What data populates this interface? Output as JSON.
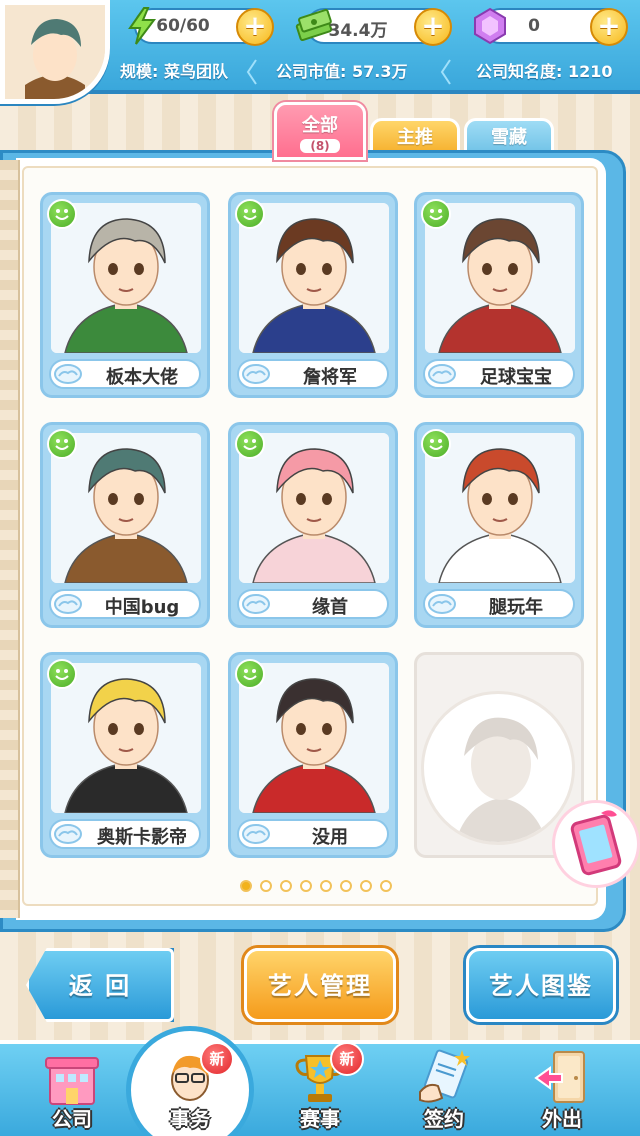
{
  "status": {
    "energy": "60/60",
    "money": "34.4万",
    "gems": "0",
    "scale": "规模: 菜鸟团队",
    "market_value": "公司市值: 57.3万",
    "fame": "公司知名度: 1210"
  },
  "tabs": [
    {
      "label": "全部",
      "count": "(8)"
    },
    {
      "label": "主推"
    },
    {
      "label": "雪藏"
    }
  ],
  "artists": [
    {
      "name": "板本大佬",
      "hair": "#b8b4a8",
      "shirt": "#3c8a3c"
    },
    {
      "name": "詹将军",
      "hair": "#6b3a22",
      "shirt": "#2b3f8c"
    },
    {
      "name": "足球宝宝",
      "hair": "#6b4632",
      "shirt": "#b4332e"
    },
    {
      "name": "中国bug",
      "hair": "#4f7a74",
      "shirt": "#8a5a2e"
    },
    {
      "name": "缘首",
      "hair": "#f59aa6",
      "shirt": "#f7d3d8"
    },
    {
      "name": "腿玩年",
      "hair": "#c94a2c",
      "shirt": "#ffffff"
    },
    {
      "name": "奥斯卡影帝",
      "hair": "#f2d24a",
      "shirt": "#2a2a2a"
    },
    {
      "name": "没用",
      "hair": "#3a3030",
      "shirt": "#c92a2a"
    }
  ],
  "page_dots": {
    "total": 8,
    "active": 0
  },
  "buttons": {
    "back": "返 回",
    "manage": "艺人管理",
    "album": "艺人图鉴"
  },
  "nav": [
    {
      "label": "公司",
      "badge": ""
    },
    {
      "label": "事务",
      "badge": "新"
    },
    {
      "label": "赛事",
      "badge": "新"
    },
    {
      "label": "签约",
      "badge": ""
    },
    {
      "label": "外出",
      "badge": ""
    }
  ],
  "colors": {
    "accent_blue": "#3aa7db",
    "accent_orange": "#f59b1b",
    "accent_pink": "#ff6f8f",
    "badge_red": "#e2262a"
  }
}
